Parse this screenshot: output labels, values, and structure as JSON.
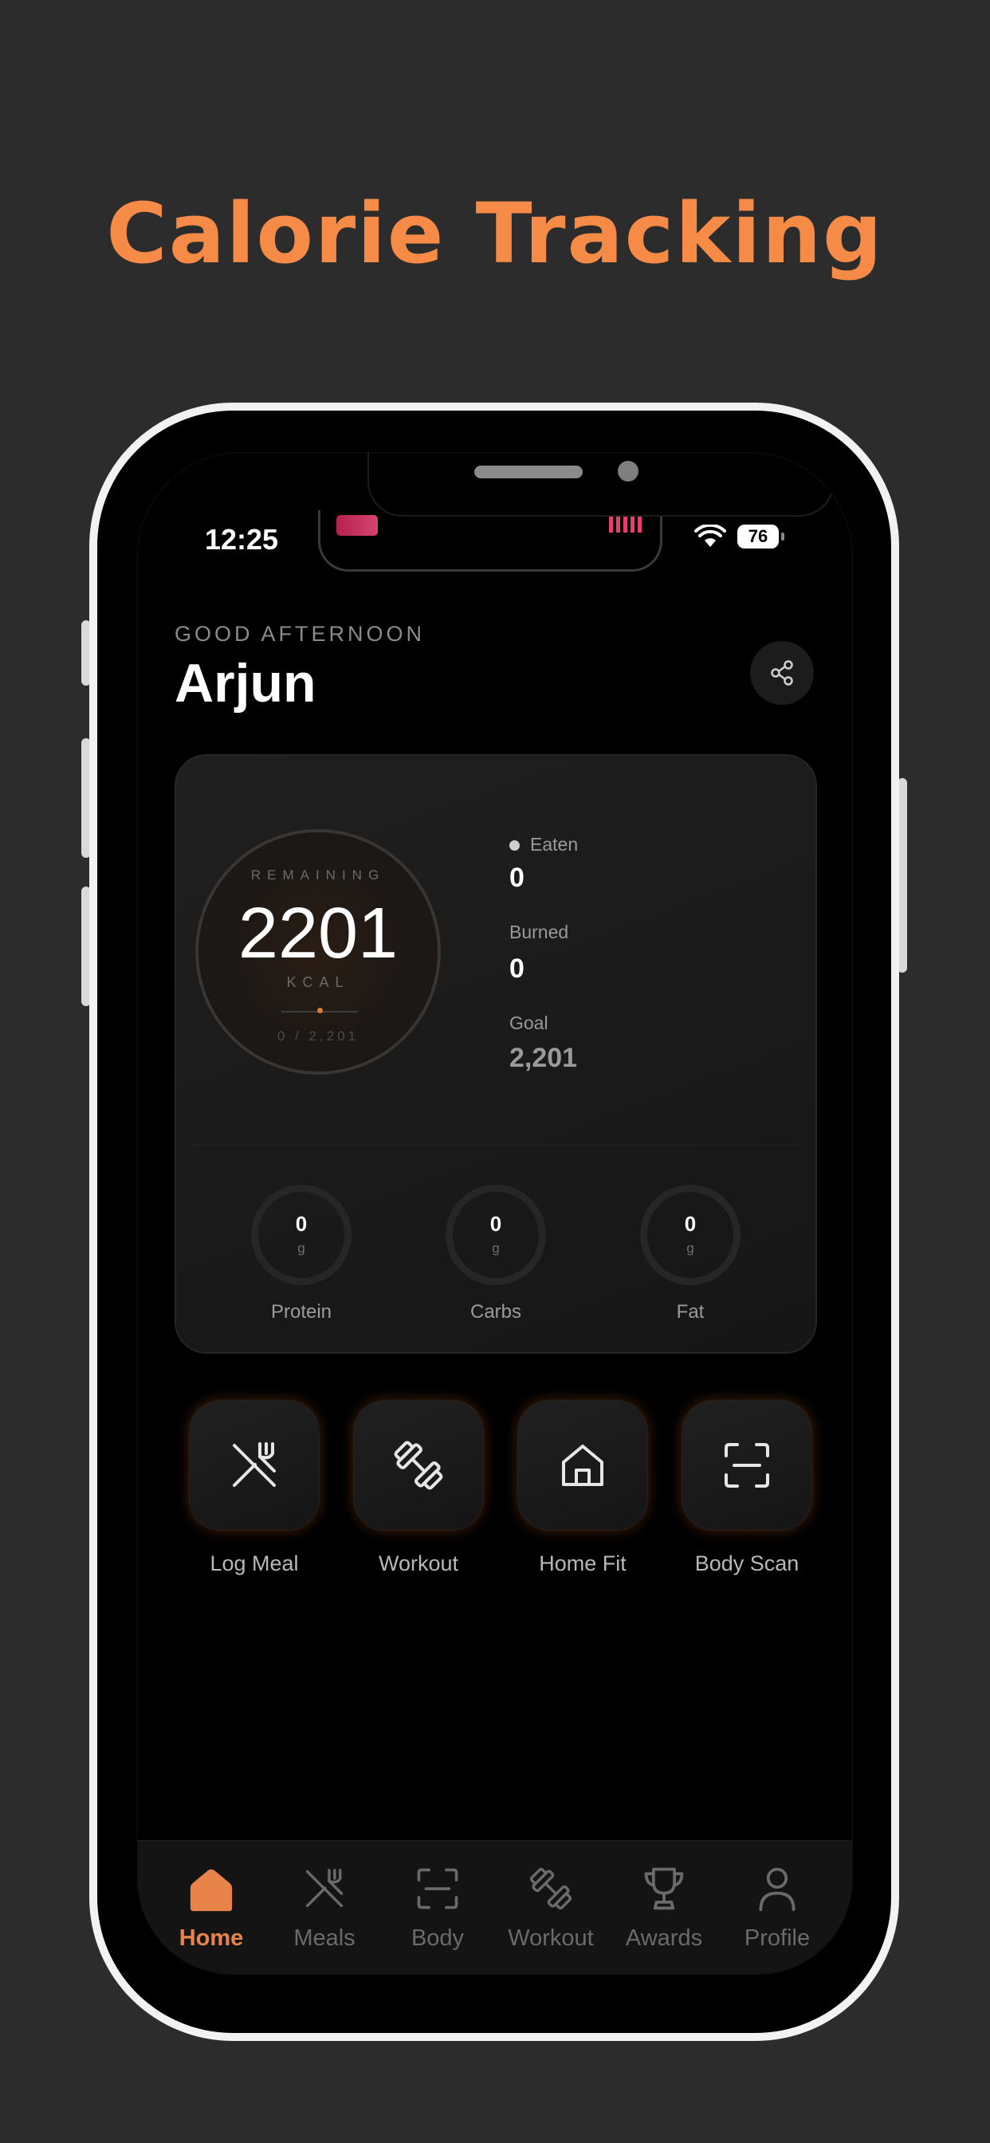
{
  "headline": "Calorie Tracking",
  "status_bar": {
    "time": "12:25",
    "battery": "76"
  },
  "header": {
    "greeting": "GOOD AFTERNOON",
    "name": "Arjun"
  },
  "summary": {
    "remaining_label": "REMAINING",
    "remaining_value": "2201",
    "unit": "KCAL",
    "progress_text": "0 / 2,201",
    "stats": [
      {
        "label": "Eaten",
        "value": "0"
      },
      {
        "label": "Burned",
        "value": "0"
      },
      {
        "label": "Goal",
        "value": "2,201"
      }
    ],
    "macros": [
      {
        "label": "Protein",
        "value": "0",
        "unit": "g"
      },
      {
        "label": "Carbs",
        "value": "0",
        "unit": "g"
      },
      {
        "label": "Fat",
        "value": "0",
        "unit": "g"
      }
    ]
  },
  "quick_actions": [
    {
      "label": "Log Meal",
      "icon": "utensils-icon"
    },
    {
      "label": "Workout",
      "icon": "dumbbell-icon"
    },
    {
      "label": "Home Fit",
      "icon": "home-icon"
    },
    {
      "label": "Body Scan",
      "icon": "scan-icon"
    }
  ],
  "tabs": [
    {
      "label": "Home",
      "icon": "home-icon",
      "active": true
    },
    {
      "label": "Meals",
      "icon": "utensils-icon"
    },
    {
      "label": "Body",
      "icon": "scan-icon"
    },
    {
      "label": "Workout",
      "icon": "dumbbell-icon"
    },
    {
      "label": "Awards",
      "icon": "trophy-icon"
    },
    {
      "label": "Profile",
      "icon": "person-icon"
    }
  ],
  "colors": {
    "accent": "#f68a47",
    "background": "#2c2c2c",
    "screen": "#000000"
  }
}
